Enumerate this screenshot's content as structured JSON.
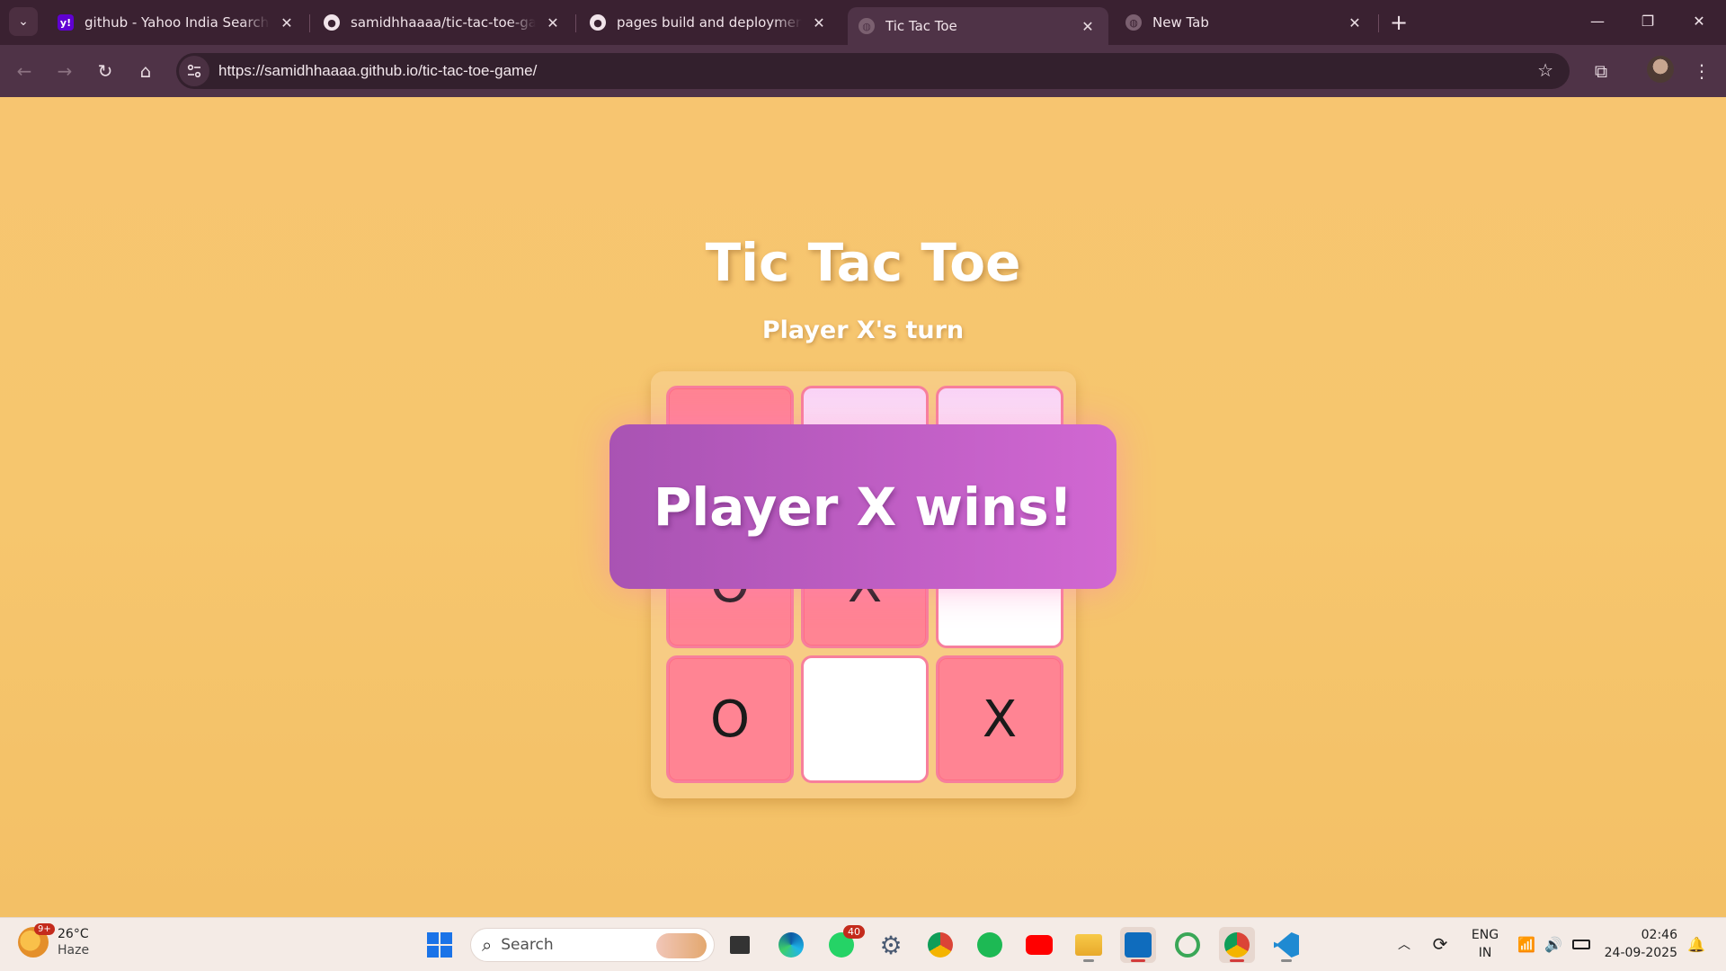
{
  "browser": {
    "tabs": [
      {
        "title": "github - Yahoo India Search Results",
        "favicon": "yahoo-icon",
        "active": false
      },
      {
        "title": "samidhhaaaa/tic-tac-toe-game",
        "favicon": "github-icon",
        "active": false
      },
      {
        "title": "pages build and deployment · samidhhaaaa/tic-tac-toe-game",
        "favicon": "github-icon",
        "active": false
      },
      {
        "title": "Tic Tac Toe",
        "favicon": "globe-icon",
        "active": true
      },
      {
        "title": "New Tab",
        "favicon": "globe-icon",
        "active": false
      }
    ],
    "url": "https://samidhhaaaa.github.io/tic-tac-toe-game/"
  },
  "game": {
    "title": "Tic Tac Toe",
    "status": "Player X's turn",
    "win_message": "Player X wins!",
    "board": [
      "",
      "",
      "",
      "O",
      "X",
      "",
      "O",
      "",
      "X"
    ]
  },
  "taskbar": {
    "weather": {
      "temp": "26°C",
      "condition": "Haze",
      "badge": "9+"
    },
    "search_placeholder": "Search",
    "whatsapp_badge": "40",
    "language": {
      "line1": "ENG",
      "line2": "IN"
    },
    "time": "02:46",
    "date": "24-09-2025"
  },
  "colors": {
    "page_bg": "#f6c46d",
    "cell_filled": "#ff8493",
    "modal_start": "#a953b3",
    "modal_end": "#d167d2"
  }
}
